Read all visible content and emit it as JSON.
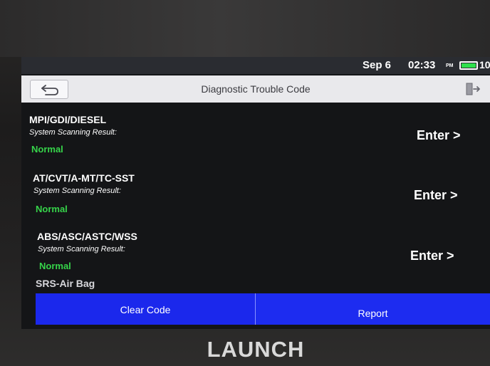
{
  "status_bar": {
    "date": "Sep 6",
    "time": "02:33",
    "ampm": "PM",
    "battery_text": "10",
    "battery_color": "#2ee04c"
  },
  "title_bar": {
    "title": "Diagnostic Trouble Code",
    "back_icon": "back-arrow-icon",
    "exit_icon": "exit-icon"
  },
  "systems": [
    {
      "name": "MPI/GDI/DIESEL",
      "scan_label": "System Scanning Result:",
      "result": "Normal",
      "enter": "Enter >"
    },
    {
      "name": "AT/CVT/A-MT/TC-SST",
      "scan_label": "System Scanning Result:",
      "result": "Normal",
      "enter": "Enter >"
    },
    {
      "name": "ABS/ASC/ASTC/WSS",
      "scan_label": "System Scanning Result:",
      "result": "Normal",
      "enter": "Enter >"
    }
  ],
  "partial_item": {
    "name": "SRS-Air Bag"
  },
  "bottom_bar": {
    "clear_code": "Clear Code",
    "report": "Report"
  },
  "brand": "LAUNCH",
  "colors": {
    "accent_blue": "#1f2ff0",
    "normal_green": "#36d44a"
  }
}
